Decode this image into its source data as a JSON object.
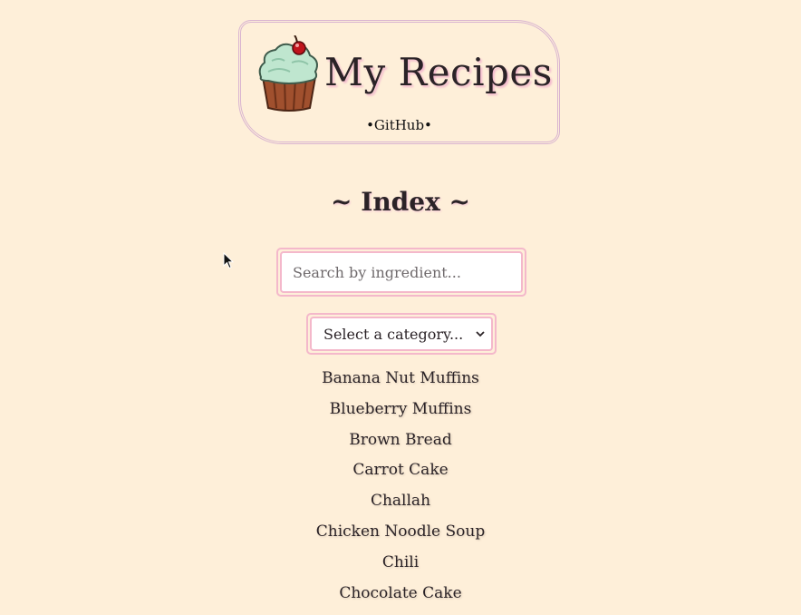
{
  "header": {
    "title": "My Recipes",
    "github_link": "•GitHub•",
    "logo_icon": "cupcake-icon"
  },
  "index": {
    "title": "~ Index ~"
  },
  "search": {
    "placeholder": "Search by ingredient...",
    "value": ""
  },
  "category_select": {
    "selected": "Select a category..."
  },
  "recipes": [
    {
      "label": "Banana Nut Muffins"
    },
    {
      "label": "Blueberry Muffins"
    },
    {
      "label": "Brown Bread"
    },
    {
      "label": "Carrot Cake"
    },
    {
      "label": "Challah"
    },
    {
      "label": "Chicken Noodle Soup"
    },
    {
      "label": "Chili"
    },
    {
      "label": "Chocolate Cake"
    }
  ],
  "colors": {
    "background": "#feefd9",
    "accent_pink": "#f4b8cb",
    "header_border": "#d9b4d0",
    "text": "#2b2327"
  }
}
